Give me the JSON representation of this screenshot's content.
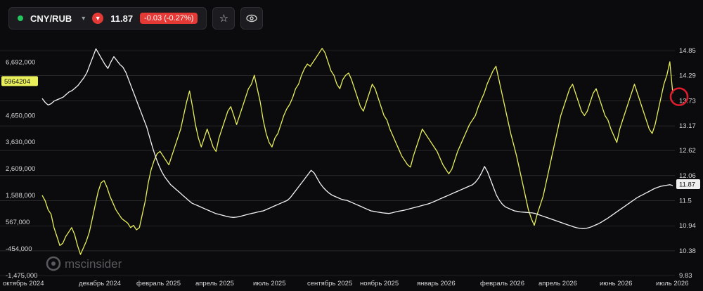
{
  "header": {
    "symbol": "CNY/RUB",
    "chevron": "▾",
    "direction_icon": "▼",
    "price": "11.87",
    "change": "-0.03 (-0.27%)",
    "star_icon": "☆",
    "eye_icon": "👁"
  },
  "watermark": "mscinsider",
  "colors": {
    "background": "#0b0b0d",
    "price_line": "#e8ef5a",
    "volume_line": "#f2f2f2",
    "grid": "#3a3a3e",
    "down": "#e53935",
    "live_dot": "#22c55e",
    "marker_circle": "#e11d2e"
  },
  "chart_data": {
    "type": "line",
    "x_tick_labels": [
      "октябрь 2024",
      "декабрь 2024",
      "февраль 2025",
      "апрель 2025",
      "июль 2025",
      "сентябрь 2025",
      "ноябрь 2025",
      "январь 2026",
      "февраль 2026",
      "апрель 2026",
      "июнь 2026",
      "июль 2026"
    ],
    "left_axis": {
      "ticks": [
        6692000,
        5671000,
        4650000,
        3630000,
        2609000,
        1588000,
        567000,
        -454000,
        -1475000
      ],
      "tick_labels": [
        "6,692,000",
        "",
        "4,650,000",
        "3,630,000",
        "2,609,000",
        "1,588,000",
        "567,000",
        "-454,000",
        "-1,475,000"
      ],
      "ylim": [
        -1475000,
        7400000
      ],
      "highlight_label": "5964204",
      "highlight_value": 5964204
    },
    "right_axis": {
      "ticks": [
        14.85,
        14.29,
        13.73,
        13.17,
        12.62,
        12.06,
        11.5,
        10.94,
        10.38,
        9.83
      ],
      "tick_labels": [
        "14.85",
        "14.29",
        "13.73",
        "13.17",
        "12.62",
        "12.06",
        "11.5",
        "10.94",
        "10.38",
        "9.83"
      ],
      "ylim": [
        9.83,
        14.85
      ],
      "highlight_label": "11.87",
      "highlight_value": 11.87
    },
    "grid": true,
    "series": [
      {
        "axis": "right",
        "color": "#e8ef5a",
        "values": [
          11.62,
          11.5,
          11.3,
          11.2,
          10.9,
          10.7,
          10.5,
          10.55,
          10.7,
          10.8,
          10.9,
          10.75,
          10.5,
          10.3,
          10.45,
          10.6,
          10.8,
          11.1,
          11.4,
          11.7,
          11.9,
          11.95,
          11.8,
          11.6,
          11.45,
          11.3,
          11.2,
          11.1,
          11.05,
          11.0,
          10.9,
          10.95,
          10.85,
          10.9,
          11.2,
          11.5,
          11.9,
          12.2,
          12.4,
          12.55,
          12.6,
          12.5,
          12.4,
          12.3,
          12.5,
          12.7,
          12.9,
          13.1,
          13.4,
          13.7,
          13.95,
          13.6,
          13.2,
          12.9,
          12.7,
          12.9,
          13.1,
          12.9,
          12.7,
          12.6,
          12.9,
          13.1,
          13.3,
          13.5,
          13.6,
          13.4,
          13.2,
          13.4,
          13.6,
          13.8,
          14.0,
          14.1,
          14.3,
          14.0,
          13.7,
          13.3,
          13.0,
          12.8,
          12.7,
          12.9,
          13.0,
          13.2,
          13.4,
          13.55,
          13.65,
          13.8,
          14.0,
          14.1,
          14.3,
          14.45,
          14.55,
          14.5,
          14.6,
          14.7,
          14.8,
          14.9,
          14.8,
          14.6,
          14.4,
          14.3,
          14.1,
          14.0,
          14.2,
          14.3,
          14.35,
          14.2,
          14.0,
          13.8,
          13.6,
          13.5,
          13.7,
          13.9,
          14.1,
          14.0,
          13.8,
          13.6,
          13.4,
          13.3,
          13.1,
          12.95,
          12.8,
          12.65,
          12.5,
          12.4,
          12.3,
          12.25,
          12.5,
          12.7,
          12.9,
          13.1,
          13.0,
          12.9,
          12.8,
          12.7,
          12.6,
          12.45,
          12.3,
          12.2,
          12.1,
          12.2,
          12.4,
          12.6,
          12.75,
          12.9,
          13.05,
          13.2,
          13.3,
          13.4,
          13.6,
          13.75,
          13.9,
          14.1,
          14.25,
          14.4,
          14.5,
          14.2,
          13.9,
          13.6,
          13.3,
          13.0,
          12.75,
          12.5,
          12.2,
          11.9,
          11.6,
          11.3,
          11.1,
          10.95,
          11.2,
          11.4,
          11.6,
          11.9,
          12.2,
          12.5,
          12.8,
          13.1,
          13.4,
          13.6,
          13.8,
          14.0,
          14.1,
          13.9,
          13.7,
          13.5,
          13.4,
          13.5,
          13.7,
          13.9,
          14.0,
          13.8,
          13.6,
          13.4,
          13.3,
          13.1,
          12.95,
          12.8,
          13.1,
          13.3,
          13.5,
          13.7,
          13.9,
          14.1,
          13.9,
          13.7,
          13.5,
          13.3,
          13.1,
          13.0,
          13.2,
          13.5,
          13.8,
          14.1,
          14.3,
          14.6,
          13.9
        ]
      },
      {
        "axis": "left",
        "color": "#f2f2f2",
        "values": [
          5300000,
          5150000,
          5050000,
          5100000,
          5200000,
          5250000,
          5300000,
          5350000,
          5450000,
          5550000,
          5600000,
          5700000,
          5800000,
          5950000,
          6100000,
          6300000,
          6600000,
          6900000,
          7200000,
          7000000,
          6800000,
          6600000,
          6450000,
          6700000,
          6900000,
          6750000,
          6600000,
          6500000,
          6300000,
          6000000,
          5700000,
          5400000,
          5100000,
          4800000,
          4500000,
          4200000,
          3800000,
          3400000,
          3050000,
          2750000,
          2500000,
          2300000,
          2150000,
          2000000,
          1900000,
          1800000,
          1700000,
          1600000,
          1500000,
          1400000,
          1300000,
          1250000,
          1200000,
          1150000,
          1100000,
          1050000,
          1000000,
          950000,
          900000,
          870000,
          840000,
          810000,
          780000,
          760000,
          750000,
          760000,
          780000,
          810000,
          840000,
          870000,
          900000,
          920000,
          950000,
          980000,
          1000000,
          1050000,
          1100000,
          1150000,
          1200000,
          1250000,
          1300000,
          1350000,
          1400000,
          1500000,
          1650000,
          1800000,
          1950000,
          2100000,
          2250000,
          2400000,
          2550000,
          2450000,
          2250000,
          2050000,
          1900000,
          1780000,
          1680000,
          1600000,
          1550000,
          1500000,
          1450000,
          1420000,
          1400000,
          1350000,
          1300000,
          1250000,
          1200000,
          1150000,
          1100000,
          1050000,
          1000000,
          980000,
          960000,
          940000,
          920000,
          910000,
          900000,
          920000,
          950000,
          980000,
          1000000,
          1020000,
          1050000,
          1080000,
          1110000,
          1140000,
          1170000,
          1200000,
          1230000,
          1260000,
          1300000,
          1350000,
          1400000,
          1450000,
          1500000,
          1550000,
          1600000,
          1650000,
          1700000,
          1750000,
          1800000,
          1850000,
          1900000,
          1950000,
          2000000,
          2100000,
          2250000,
          2450000,
          2700000,
          2500000,
          2200000,
          1900000,
          1600000,
          1400000,
          1250000,
          1150000,
          1100000,
          1050000,
          1000000,
          980000,
          960000,
          950000,
          940000,
          930000,
          920000,
          900000,
          860000,
          820000,
          780000,
          740000,
          700000,
          660000,
          620000,
          580000,
          540000,
          500000,
          460000,
          420000,
          380000,
          350000,
          330000,
          320000,
          330000,
          360000,
          400000,
          450000,
          500000,
          560000,
          630000,
          700000,
          780000,
          860000,
          940000,
          1020000,
          1100000,
          1180000,
          1260000,
          1340000,
          1420000,
          1500000,
          1560000,
          1620000,
          1680000,
          1740000,
          1800000,
          1860000,
          1900000,
          1940000,
          1960000,
          1980000,
          2000000,
          1970000
        ]
      }
    ],
    "annotations": [
      {
        "type": "circle",
        "axis": "right",
        "value": 13.82,
        "position": "right-edge"
      }
    ]
  }
}
